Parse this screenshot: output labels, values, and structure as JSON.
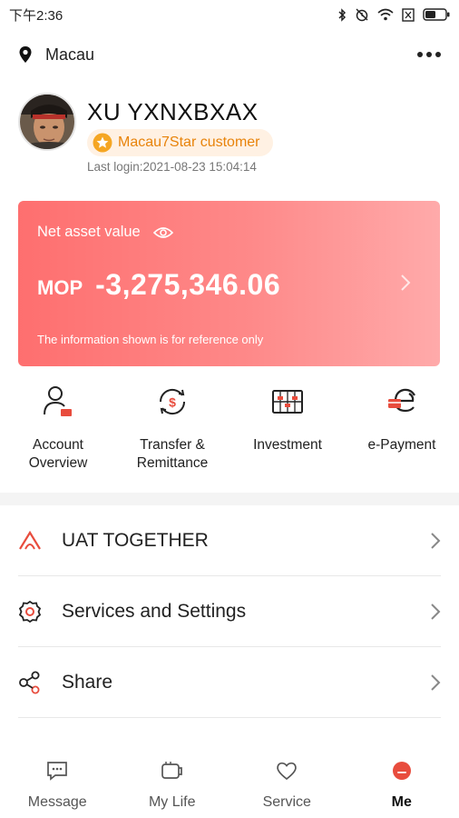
{
  "status_bar": {
    "time": "下午2:36",
    "icons": [
      "bluetooth-icon",
      "alarm-icon",
      "wifi-icon",
      "sim-icon",
      "battery-icon"
    ]
  },
  "location": {
    "name": "Macau",
    "icon": "location-pin-icon",
    "more": "more-options-icon"
  },
  "profile": {
    "name": "XU YXNXBXAX",
    "badge": "Macau7Star customer",
    "last_login": "Last login:2021-08-23 15:04:14"
  },
  "asset_card": {
    "label": "Net asset value",
    "currency": "MOP",
    "amount": "-3,275,346.06",
    "note": "The information shown is for reference only",
    "colors": {
      "start": "#fe6f6f",
      "end": "#ffaaaa"
    }
  },
  "quick_actions": [
    {
      "label": "Account\nOverview",
      "icon": "account-overview-icon"
    },
    {
      "label": "Transfer &\nRemittance",
      "icon": "transfer-icon"
    },
    {
      "label": "Investment",
      "icon": "investment-icon"
    },
    {
      "label": "e-Payment",
      "icon": "e-payment-icon"
    }
  ],
  "menu": [
    {
      "label": "UAT TOGETHER",
      "icon": "together-icon"
    },
    {
      "label": "Services and Settings",
      "icon": "settings-gear-icon"
    },
    {
      "label": "Share",
      "icon": "share-icon"
    }
  ],
  "tabs": [
    {
      "label": "Message",
      "icon": "message-icon",
      "active": false
    },
    {
      "label": "My Life",
      "icon": "my-life-icon",
      "active": false
    },
    {
      "label": "Service",
      "icon": "heart-icon",
      "active": false
    },
    {
      "label": "Me",
      "icon": "me-icon",
      "active": true
    }
  ],
  "accent_color": "#e84c3d"
}
